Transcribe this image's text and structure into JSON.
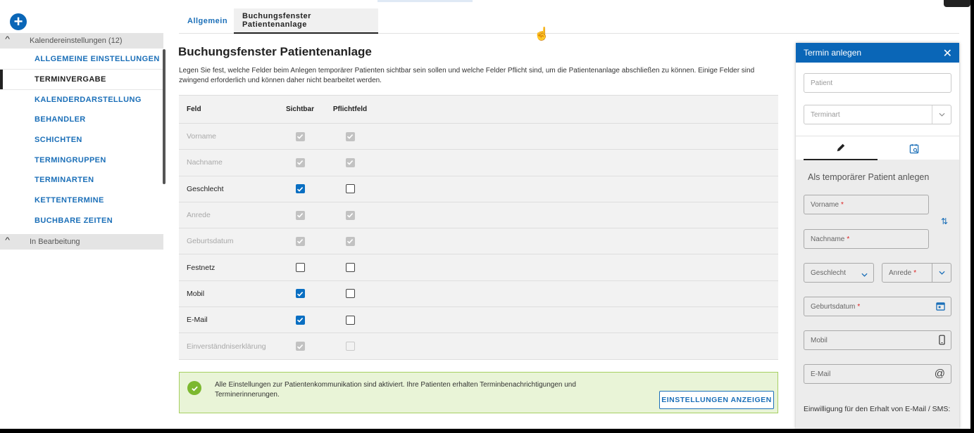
{
  "sidebar": {
    "add_label": "+",
    "group1": {
      "label": "Kalendereinstellungen (12)"
    },
    "items": [
      {
        "label": "ALLGEMEINE EINSTELLUNGEN",
        "active": false
      },
      {
        "label": "TERMINVERGABE",
        "active": true
      },
      {
        "label": "KALENDERDARSTELLUNG",
        "active": false
      },
      {
        "label": "BEHANDLER",
        "active": false
      },
      {
        "label": "SCHICHTEN",
        "active": false
      },
      {
        "label": "TERMINGRUPPEN",
        "active": false
      },
      {
        "label": "TERMINARTEN",
        "active": false
      },
      {
        "label": "KETTENTERMINE",
        "active": false
      },
      {
        "label": "BUCHBARE ZEITEN",
        "active": false
      }
    ],
    "group2": {
      "label": "In Bearbeitung"
    }
  },
  "tabs": [
    {
      "label": "Allgemein"
    },
    {
      "label": "Buchungsfenster Patientenanlage"
    }
  ],
  "page": {
    "title": "Buchungsfenster Patientenanlage",
    "description": "Legen Sie fest, welche Felder beim Anlegen temporärer Patienten sichtbar sein sollen und welche Felder Pflicht sind, um die Patientenanlage abschließen zu können. Einige Felder sind zwingend erforderlich und können daher nicht bearbeitet werden."
  },
  "table": {
    "headers": {
      "field": "Feld",
      "visible": "Sichtbar",
      "required": "Pflichtfeld"
    },
    "rows": [
      {
        "field": "Vorname",
        "editable": false,
        "visible": true,
        "required": true
      },
      {
        "field": "Nachname",
        "editable": false,
        "visible": true,
        "required": true
      },
      {
        "field": "Geschlecht",
        "editable": true,
        "visible": true,
        "required": false
      },
      {
        "field": "Anrede",
        "editable": false,
        "visible": true,
        "required": true
      },
      {
        "field": "Geburtsdatum",
        "editable": false,
        "visible": true,
        "required": true
      },
      {
        "field": "Festnetz",
        "editable": true,
        "visible": false,
        "required": false
      },
      {
        "field": "Mobil",
        "editable": true,
        "visible": true,
        "required": false
      },
      {
        "field": "E-Mail",
        "editable": true,
        "visible": true,
        "required": false
      },
      {
        "field": "Einverständniserklärung",
        "editable": false,
        "visible": true,
        "required": false
      }
    ]
  },
  "notice": {
    "text": "Alle Einstellungen zur Patientenkommunikation sind aktiviert. Ihre Patienten erhalten Terminbenachrichtigungen und Terminerinnerungen.",
    "button": "EINSTELLUNGEN ANZEIGEN"
  },
  "panel": {
    "title": "Termin anlegen",
    "patient_placeholder": "Patient",
    "terminart_placeholder": "Terminart",
    "subtitle": "Als temporärer Patient anlegen",
    "fields": {
      "vorname": "Vorname",
      "nachname": "Nachname",
      "geschlecht": "Geschlecht",
      "anrede": "Anrede",
      "geburtsdatum": "Geburtsdatum",
      "mobil": "Mobil",
      "email": "E-Mail"
    },
    "required_mark": "*",
    "consent": "Einwilligung für den Erhalt von E-Mail / SMS:"
  },
  "colors": {
    "primary": "#0a66b7",
    "success": "#7cb82f",
    "success_bg": "#e9f4d7"
  }
}
